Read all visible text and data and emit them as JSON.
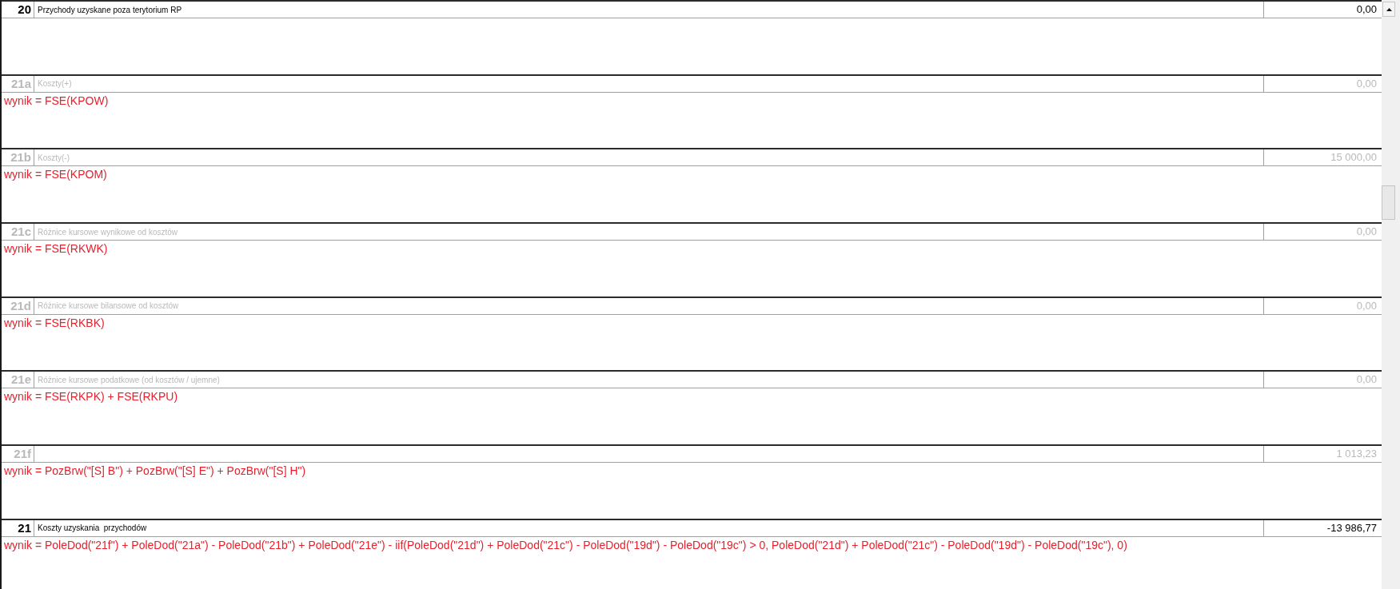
{
  "rows": [
    {
      "number": "20",
      "label": "Przychody uzyskane poza terytorium RP",
      "value": "0,00",
      "disabled": false
    },
    {
      "number": "21a",
      "label": "Koszty(+)",
      "value": "0,00",
      "disabled": true,
      "formula": "wynik = FSE(KPOW)"
    },
    {
      "number": "21b",
      "label": "Koszty(-)",
      "value": "15 000,00",
      "disabled": true,
      "formula": "wynik = FSE(KPOM)"
    },
    {
      "number": "21c",
      "label": "Różnice kursowe wynikowe od kosztów",
      "value": "0,00",
      "disabled": true,
      "formula": "wynik = FSE(RKWK)"
    },
    {
      "number": "21d",
      "label": "Różnice kursowe bilansowe od kosztów",
      "value": "0,00",
      "disabled": true,
      "formula": "wynik = FSE(RKBK)"
    },
    {
      "number": "21e",
      "label": "Różnice kursowe podatkowe (od kosztów / ujemne)",
      "value": "0,00",
      "disabled": true,
      "formula": "wynik = FSE(RKPK) + FSE(RKPU)"
    },
    {
      "number": "21f",
      "value": "1 013,23",
      "disabled": true,
      "formula": "wynik = PozBrw(\"[S] B\") + PozBrw(\"[S] E\") + PozBrw(\"[S] H\")"
    },
    {
      "number": "21",
      "label": "Koszty uzyskania  przychodów",
      "value": "-13 986,77",
      "disabled": false,
      "formula": "wynik = PoleDod(\"21f\") + PoleDod(\"21a\") - PoleDod(\"21b\") + PoleDod(\"21e\") - iif(PoleDod(\"21d\") + PoleDod(\"21c\") - PoleDod(\"19d\") - PoleDod(\"19c\") > 0, PoleDod(\"21d\") + PoleDod(\"21c\") - PoleDod(\"19d\") - PoleDod(\"19c\"), 0)"
    }
  ]
}
